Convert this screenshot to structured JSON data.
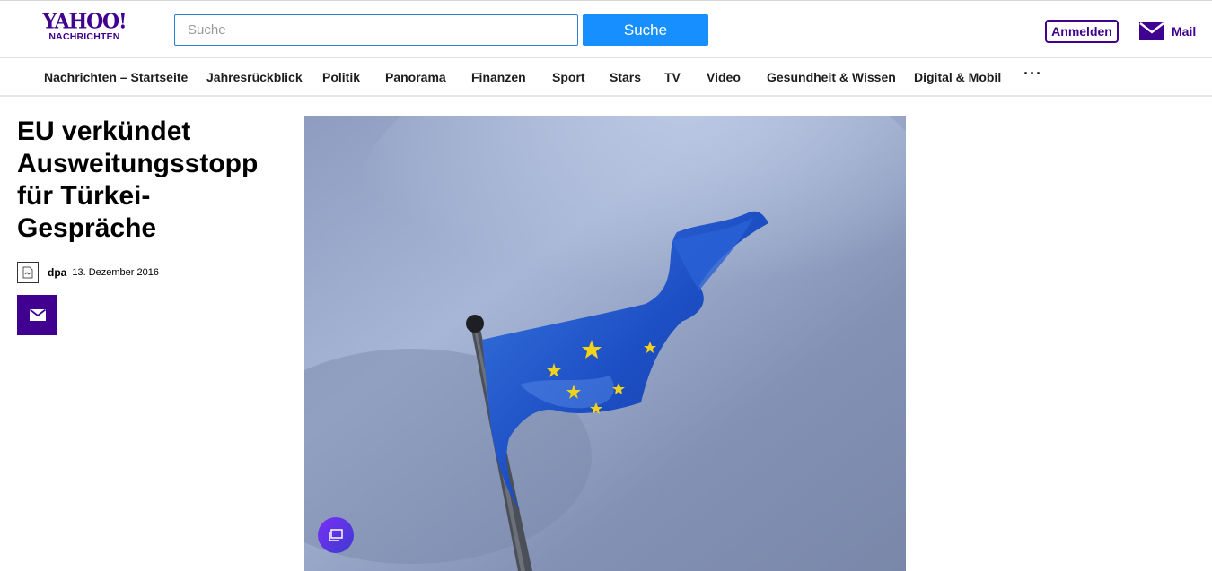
{
  "header": {
    "logo": {
      "main": "YAHOO!",
      "sub": "NACHRICHTEN"
    },
    "search": {
      "placeholder": "Suche",
      "value": "",
      "button_label": "Suche"
    },
    "login_label": "Anmelden",
    "mail_label": "Mail"
  },
  "nav": {
    "items": [
      "Nachrichten – Startseite",
      "Jahresrückblick",
      "Politik",
      "Panorama",
      "Finanzen",
      "Sport",
      "Stars",
      "TV",
      "Video",
      "Gesundheit & Wissen",
      "Digital & Mobil"
    ],
    "more_label": "···"
  },
  "article": {
    "title": "EU verkündet Ausweitungsstopp für Türkei-Gespräche",
    "source": "dpa",
    "date": "13. Dezember 2016"
  },
  "colors": {
    "brand": "#400090",
    "search_button": "#188fff",
    "search_border": "#2d7ed7"
  },
  "icons": {
    "mail": "mail-envelope-icon",
    "share": "share-mail-icon",
    "gallery": "gallery-icon",
    "source": "source-logo-icon"
  }
}
